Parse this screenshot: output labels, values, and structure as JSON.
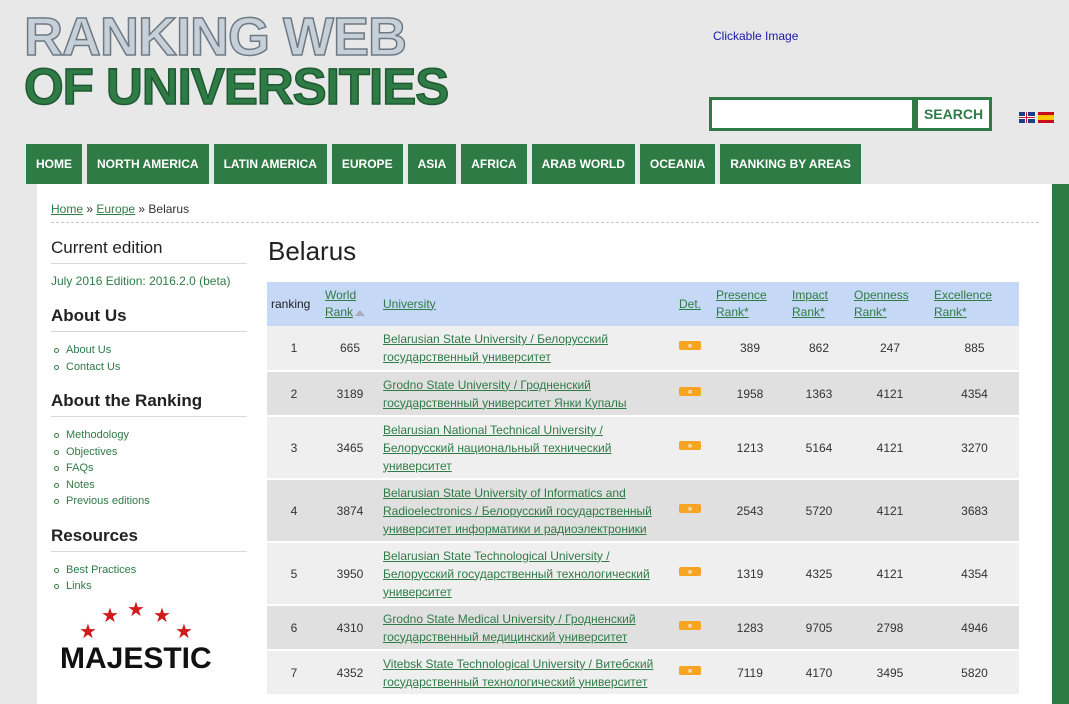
{
  "header": {
    "logo_line1": "RANKING WEB",
    "logo_line2": "OF UNIVERSITIES",
    "clickable_image_label": "Clickable Image",
    "search_value": "",
    "search_button": "SEARCH",
    "languages": [
      "english-flag-icon",
      "spanish-flag-icon"
    ],
    "brand_color": "#2f7b46"
  },
  "nav": [
    "HOME",
    "NORTH AMERICA",
    "LATIN AMERICA",
    "EUROPE",
    "ASIA",
    "AFRICA",
    "ARAB WORLD",
    "OCEANIA",
    "RANKING BY AREAS"
  ],
  "breadcrumb": {
    "home": "Home",
    "sep1": " » ",
    "europe": "Europe",
    "sep2": " » ",
    "current": "Belarus"
  },
  "sidebar": {
    "current_edition_title": "Current edition",
    "current_edition_value": "July 2016 Edition: 2016.2.0 (beta)",
    "about_us_title": "About Us",
    "about_us_items": [
      "About Us",
      "Contact Us"
    ],
    "about_ranking_title": "About the Ranking",
    "about_ranking_items": [
      "Methodology",
      "Objectives",
      "FAQs",
      "Notes",
      "Previous editions"
    ],
    "resources_title": "Resources",
    "resources_items": [
      "Best Practices",
      "Links"
    ],
    "sponsor_logo_text": "MAJESTIC"
  },
  "page_title": "Belarus",
  "table": {
    "headers": {
      "ranking": "ranking",
      "world_rank_1": "World",
      "world_rank_2": "Rank",
      "university": "University",
      "det": "Det.",
      "presence_1": "Presence",
      "presence_2": "Rank*",
      "impact_1": "Impact",
      "impact_2": "Rank*",
      "openness_1": "Openness",
      "openness_2": "Rank*",
      "excellence_1": "Excellence",
      "excellence_2": "Rank*"
    },
    "det_icon": "»",
    "rows": [
      {
        "ranking": "1",
        "world_rank": "665",
        "university": "Belarusian State University / Белорусский государственный университет",
        "presence": "389",
        "impact": "862",
        "openness": "247",
        "excellence": "885"
      },
      {
        "ranking": "2",
        "world_rank": "3189",
        "university": "Grodno State University / Гродненский государственный университет Янки Купалы",
        "presence": "1958",
        "impact": "1363",
        "openness": "4121",
        "excellence": "4354"
      },
      {
        "ranking": "3",
        "world_rank": "3465",
        "university": "Belarusian National Technical University / Белорусский национальный технический университет",
        "presence": "1213",
        "impact": "5164",
        "openness": "4121",
        "excellence": "3270"
      },
      {
        "ranking": "4",
        "world_rank": "3874",
        "university": "Belarusian State University of Informatics and Radioelectronics / Белорусский государственный университет информатики и радиоэлектроники",
        "presence": "2543",
        "impact": "5720",
        "openness": "4121",
        "excellence": "3683"
      },
      {
        "ranking": "5",
        "world_rank": "3950",
        "university": "Belarusian State Technological University / Белорусский государственный технологический университет",
        "presence": "1319",
        "impact": "4325",
        "openness": "4121",
        "excellence": "4354"
      },
      {
        "ranking": "6",
        "world_rank": "4310",
        "university": "Grodno State Medical University / Гродненский государственный медицинский университет",
        "presence": "1283",
        "impact": "9705",
        "openness": "2798",
        "excellence": "4946"
      },
      {
        "ranking": "7",
        "world_rank": "4352",
        "university": "Vitebsk State Technological University / Витебский государственный технологический университет",
        "presence": "7119",
        "impact": "4170",
        "openness": "3495",
        "excellence": "5820"
      }
    ]
  }
}
